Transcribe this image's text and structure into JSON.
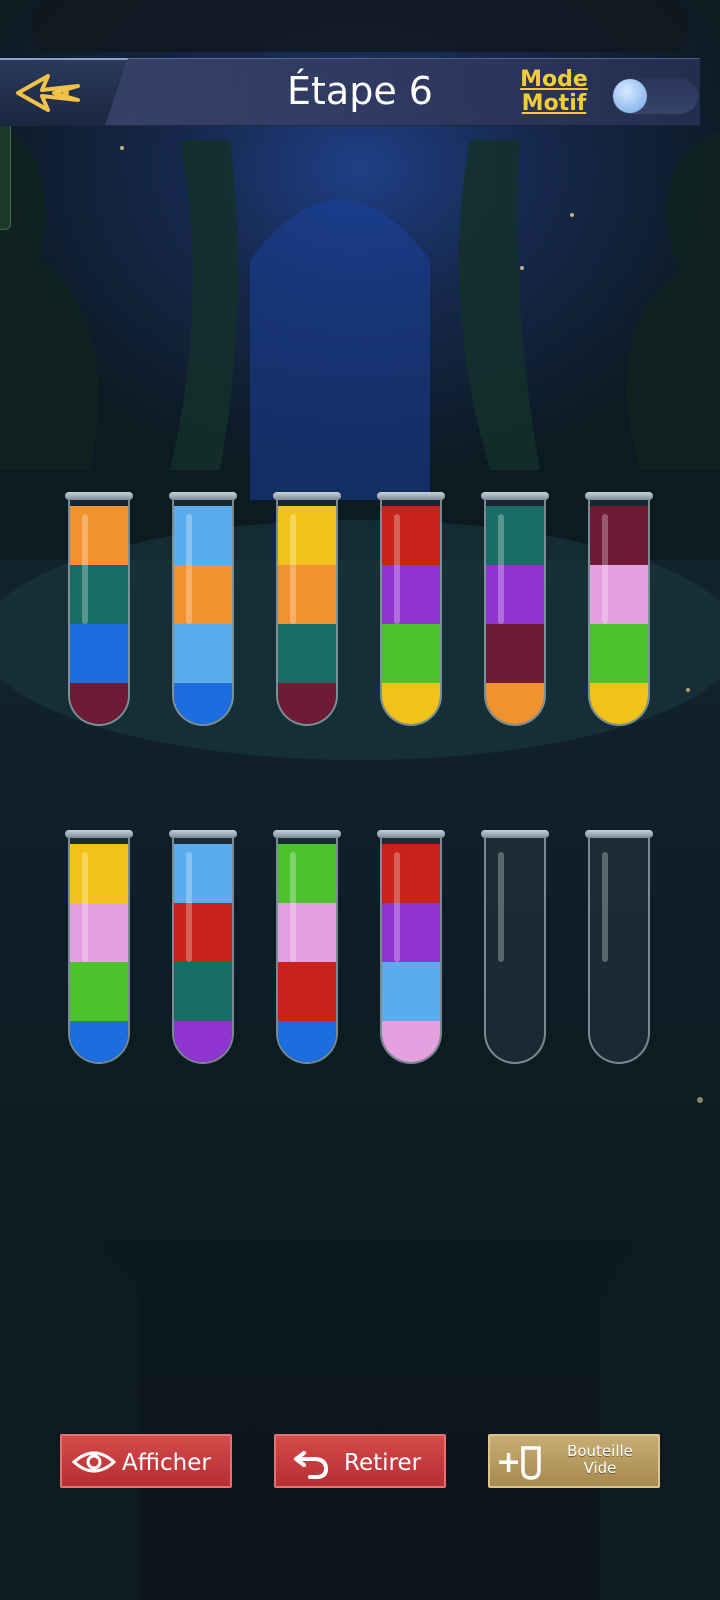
{
  "header": {
    "title": "Étape 6",
    "mode_line1": "Mode",
    "mode_line2": "Motif",
    "back_icon": "back-arrow-icon",
    "toggle_state": "off"
  },
  "colors": {
    "orange": "#f0922e",
    "teal": "#1a6d66",
    "blue": "#1c6de0",
    "maroon": "#6f1b35",
    "lightblue": "#5aacec",
    "yellow": "#f3c21a",
    "red": "#c8221a",
    "purple": "#8f34cf",
    "green": "#4cc22f",
    "pink": "#e4a0df",
    "accent": "#f2cd36"
  },
  "tubes": [
    [
      "orange",
      "teal",
      "blue",
      "maroon"
    ],
    [
      "lightblue",
      "orange",
      "lightblue",
      "blue"
    ],
    [
      "yellow",
      "orange",
      "teal",
      "maroon"
    ],
    [
      "red",
      "purple",
      "green",
      "yellow"
    ],
    [
      "teal",
      "purple",
      "maroon",
      "orange"
    ],
    [
      "maroon",
      "pink",
      "green",
      "yellow"
    ],
    [
      "yellow",
      "pink",
      "green",
      "blue"
    ],
    [
      "lightblue",
      "red",
      "teal",
      "purple"
    ],
    [
      "green",
      "pink",
      "red",
      "blue"
    ],
    [
      "red",
      "purple",
      "lightblue",
      "pink"
    ],
    [],
    []
  ],
  "buttons": {
    "show_label": "Afficher",
    "undo_label": "Retirer",
    "bottle_line1": "Bouteille",
    "bottle_line2": "Vide",
    "bottle_plus": "+"
  }
}
